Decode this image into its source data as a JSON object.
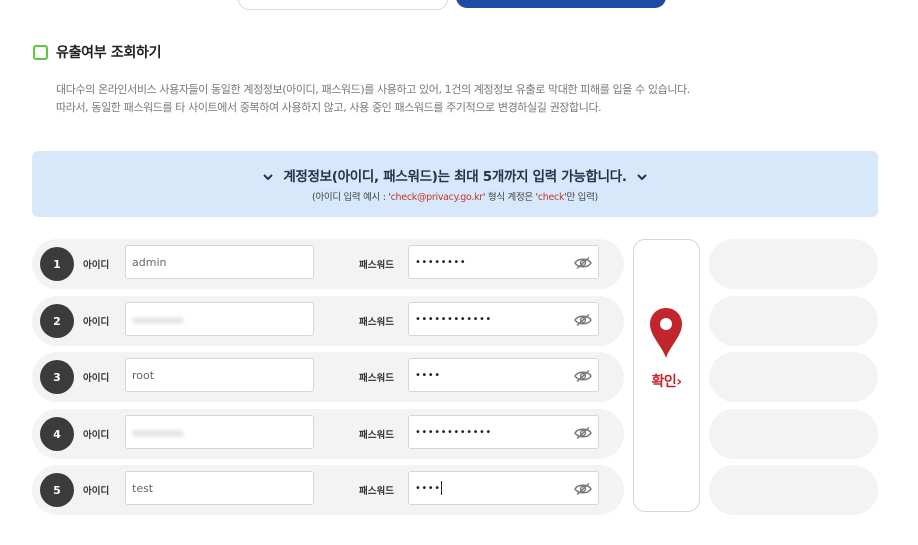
{
  "section": {
    "title": "유출여부 조회하기",
    "desc_line1": "대다수의 온라인서비스 사용자들이 동일한 계정정보(아이디, 패스워드)를 사용하고 있어, 1건의 계정정보 유출로 막대한 피해를 입을 수 있습니다.",
    "desc_line2": "따라서, 동일한 패스워드를 타 사이트에서 중복하여 사용하지 않고, 사용 중인 패스워드를 주기적으로 변경하실길 권장합니다."
  },
  "banner": {
    "title": "계정정보(아이디, 패스워드)는 최대 5개까지 입력 가능합니다.",
    "sub_prefix": "(아이디 입력 예시 : '",
    "sub_example": "check@privacy.go.kr",
    "sub_mid": "' 형식 계정은 '",
    "sub_check": "check",
    "sub_suffix": "'만 입력)"
  },
  "form": {
    "id_label": "아이디",
    "pw_label": "패스워드",
    "rows": [
      {
        "num": "1",
        "id": "admin",
        "pw": "••••••••"
      },
      {
        "num": "2",
        "id": "",
        "pw": "••••••••••••"
      },
      {
        "num": "3",
        "id": "root",
        "pw": "••••"
      },
      {
        "num": "4",
        "id": "",
        "pw": "••••••••••••"
      },
      {
        "num": "5",
        "id": "test",
        "pw": "••••"
      }
    ]
  },
  "confirm": {
    "label": "확인",
    "arrow": "›"
  },
  "icons": {
    "check": "check-box-icon",
    "eye": "eye-slash-icon",
    "pin": "location-pin-icon",
    "chevron": "chevron-down-icon"
  },
  "colors": {
    "brand_blue": "#1f4aa5",
    "banner_bg": "#d8e8fb",
    "accent_red": "#c0262c",
    "check_green": "#5ac83a"
  }
}
